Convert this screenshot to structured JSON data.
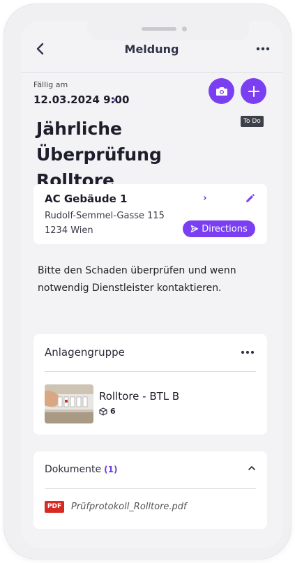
{
  "header": {
    "title": "Meldung",
    "back_icon": "chevron-left-icon",
    "more_icon": "more-horizontal-icon"
  },
  "due": {
    "label": "Fällig am",
    "date": "12.03.2024 9:00",
    "chevron": "›"
  },
  "actions": {
    "camera_icon": "camera-icon",
    "add_icon": "plus-icon",
    "status_tag": "To Do",
    "accent_color": "#7b3ff2"
  },
  "title": "Jährliche Überprüfung Rolltore",
  "location": {
    "name": "AC Gebäude 1",
    "street": "Rudolf-Semmel-Gasse 115",
    "city": "1234 Wien",
    "chevron": "›",
    "directions_label": "Directions",
    "edit_icon": "pencil-icon"
  },
  "description": "Bitte den Schaden überprüfen und wenn notwendig Dienstleister kontaktieren.",
  "asset_group": {
    "header": "Anlagengruppe",
    "item": {
      "name": "Rolltore - BTL B",
      "count": "6",
      "count_icon": "box-icon"
    }
  },
  "documents": {
    "title": "Dokumente",
    "count": "(1)",
    "items": [
      {
        "type": "PDF",
        "name": "Prüfprotokoll_Rolltore.pdf"
      }
    ]
  }
}
